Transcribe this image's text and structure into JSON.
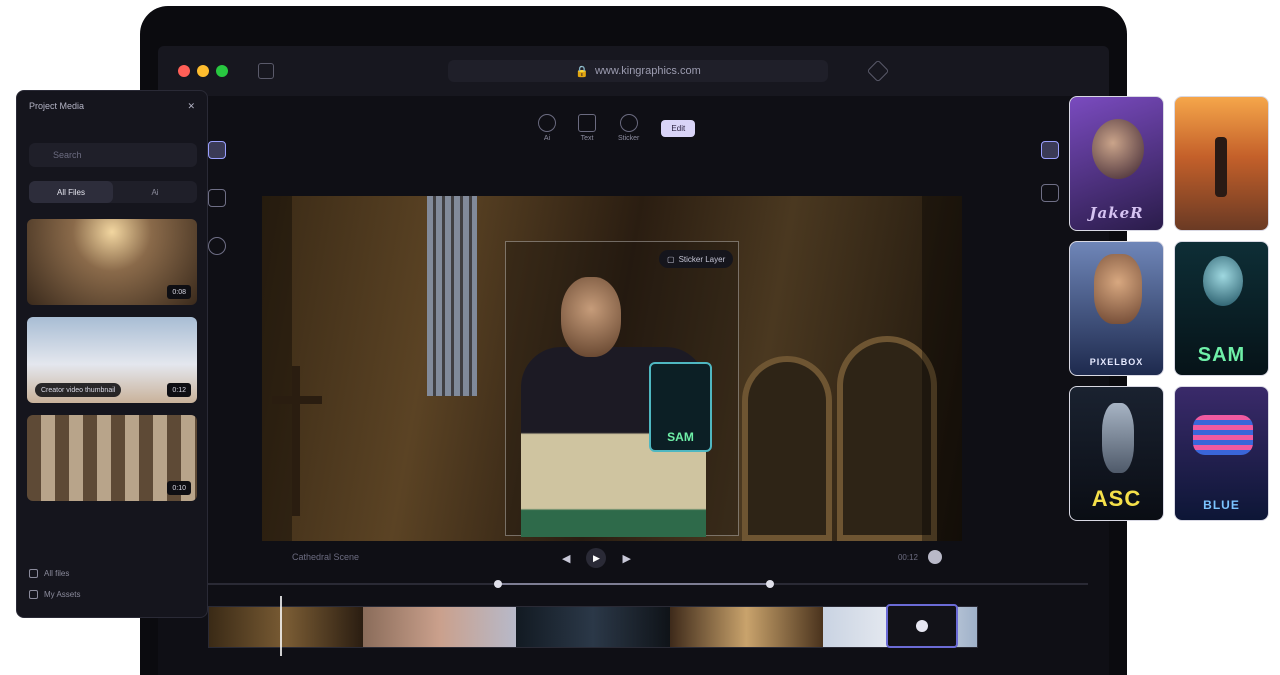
{
  "browser": {
    "url": "www.kingraphics.com",
    "traffic_lights": [
      "#ff5f57",
      "#febc2e",
      "#28c840"
    ]
  },
  "toolbar": {
    "tools": [
      {
        "icon": "avatar-icon",
        "label": "Ai"
      },
      {
        "icon": "text-icon",
        "label": "Text"
      },
      {
        "icon": "sticker-icon",
        "label": "Sticker"
      }
    ],
    "primary_button": "Edit"
  },
  "panel": {
    "title": "Project Media",
    "search_placeholder": "Search",
    "tabs": [
      "All Files",
      "Ai"
    ],
    "active_tab": 0,
    "thumbnails": [
      {
        "duration": "0:08"
      },
      {
        "caption": "Creator video thumbnail",
        "duration": "0:12"
      },
      {
        "duration": "0:10"
      }
    ],
    "footer": [
      "All files",
      "My Assets"
    ]
  },
  "video": {
    "overlay_tag": "Sticker Layer",
    "sticker_text": "SAM",
    "footer_label": "Cathedral Scene",
    "right_label": "00:12"
  },
  "avatars": [
    {
      "label": "JakeR",
      "color": "#d6c3f2"
    },
    {
      "label": "",
      "color": "#f3b56a"
    },
    {
      "label": "PIXELBOX",
      "color": "#e6e9ff"
    },
    {
      "label": "SAM",
      "color": "#6ff0a8"
    },
    {
      "label": "ASC",
      "color": "#f5e04a"
    },
    {
      "label": "BLUE",
      "color": "#7bc3ff"
    }
  ],
  "accent": "#6b6bd6"
}
